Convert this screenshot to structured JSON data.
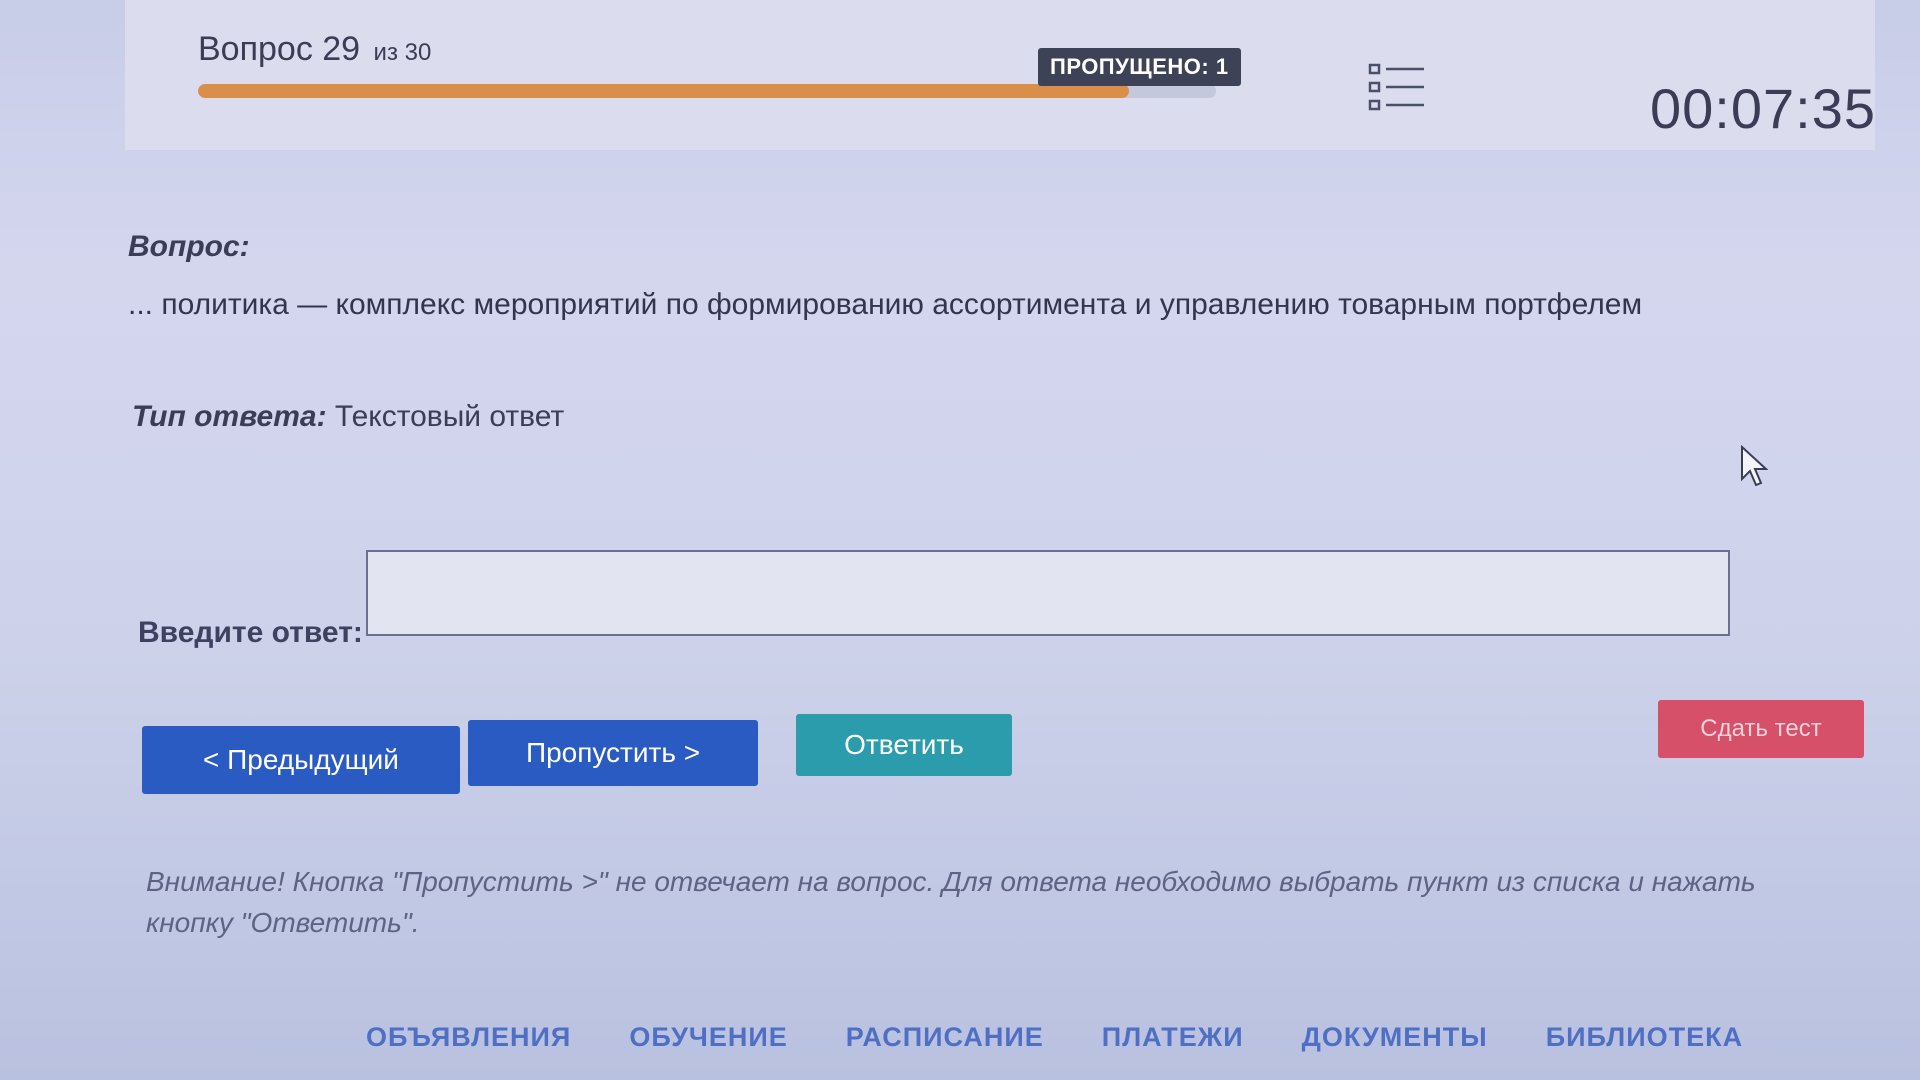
{
  "header": {
    "question_label": "Вопрос 29",
    "question_of": "из 30",
    "progress_fraction": 0.915,
    "skipped_badge": "ПРОПУЩЕНО: 1",
    "list_icon": "list-icon",
    "timer": "00:07:35"
  },
  "question": {
    "heading": "Вопрос:",
    "text": "... политика — комплекс мероприятий по формированию ассортимента и управлению товарным портфелем",
    "answer_type_label": "Тип ответа:",
    "answer_type_value": "Текстовый ответ"
  },
  "answer": {
    "label": "Введите ответ:",
    "value": ""
  },
  "buttons": {
    "prev": "< Предыдущий",
    "skip": "Пропустить >",
    "answer": "Ответить",
    "finish": "Сдать тест"
  },
  "warning": "Внимание! Кнопка \"Пропустить >\" не отвечает на вопрос. Для ответа необходимо выбрать пункт из списка и нажать кнопку \"Ответить\".",
  "bottom_nav": {
    "items": [
      "ОБЪЯВЛЕНИЯ",
      "ОБУЧЕНИЕ",
      "РАСПИСАНИЕ",
      "ПЛАТЕЖИ",
      "ДОКУМЕНТЫ",
      "БИБЛИОТЕКА"
    ]
  },
  "colors": {
    "accent_blue": "#2a5bc2",
    "answer_teal": "#2a9cab",
    "finish_red": "#d6506a",
    "progress_orange": "#d98e4a",
    "nav_blue": "#4e6fc4"
  }
}
